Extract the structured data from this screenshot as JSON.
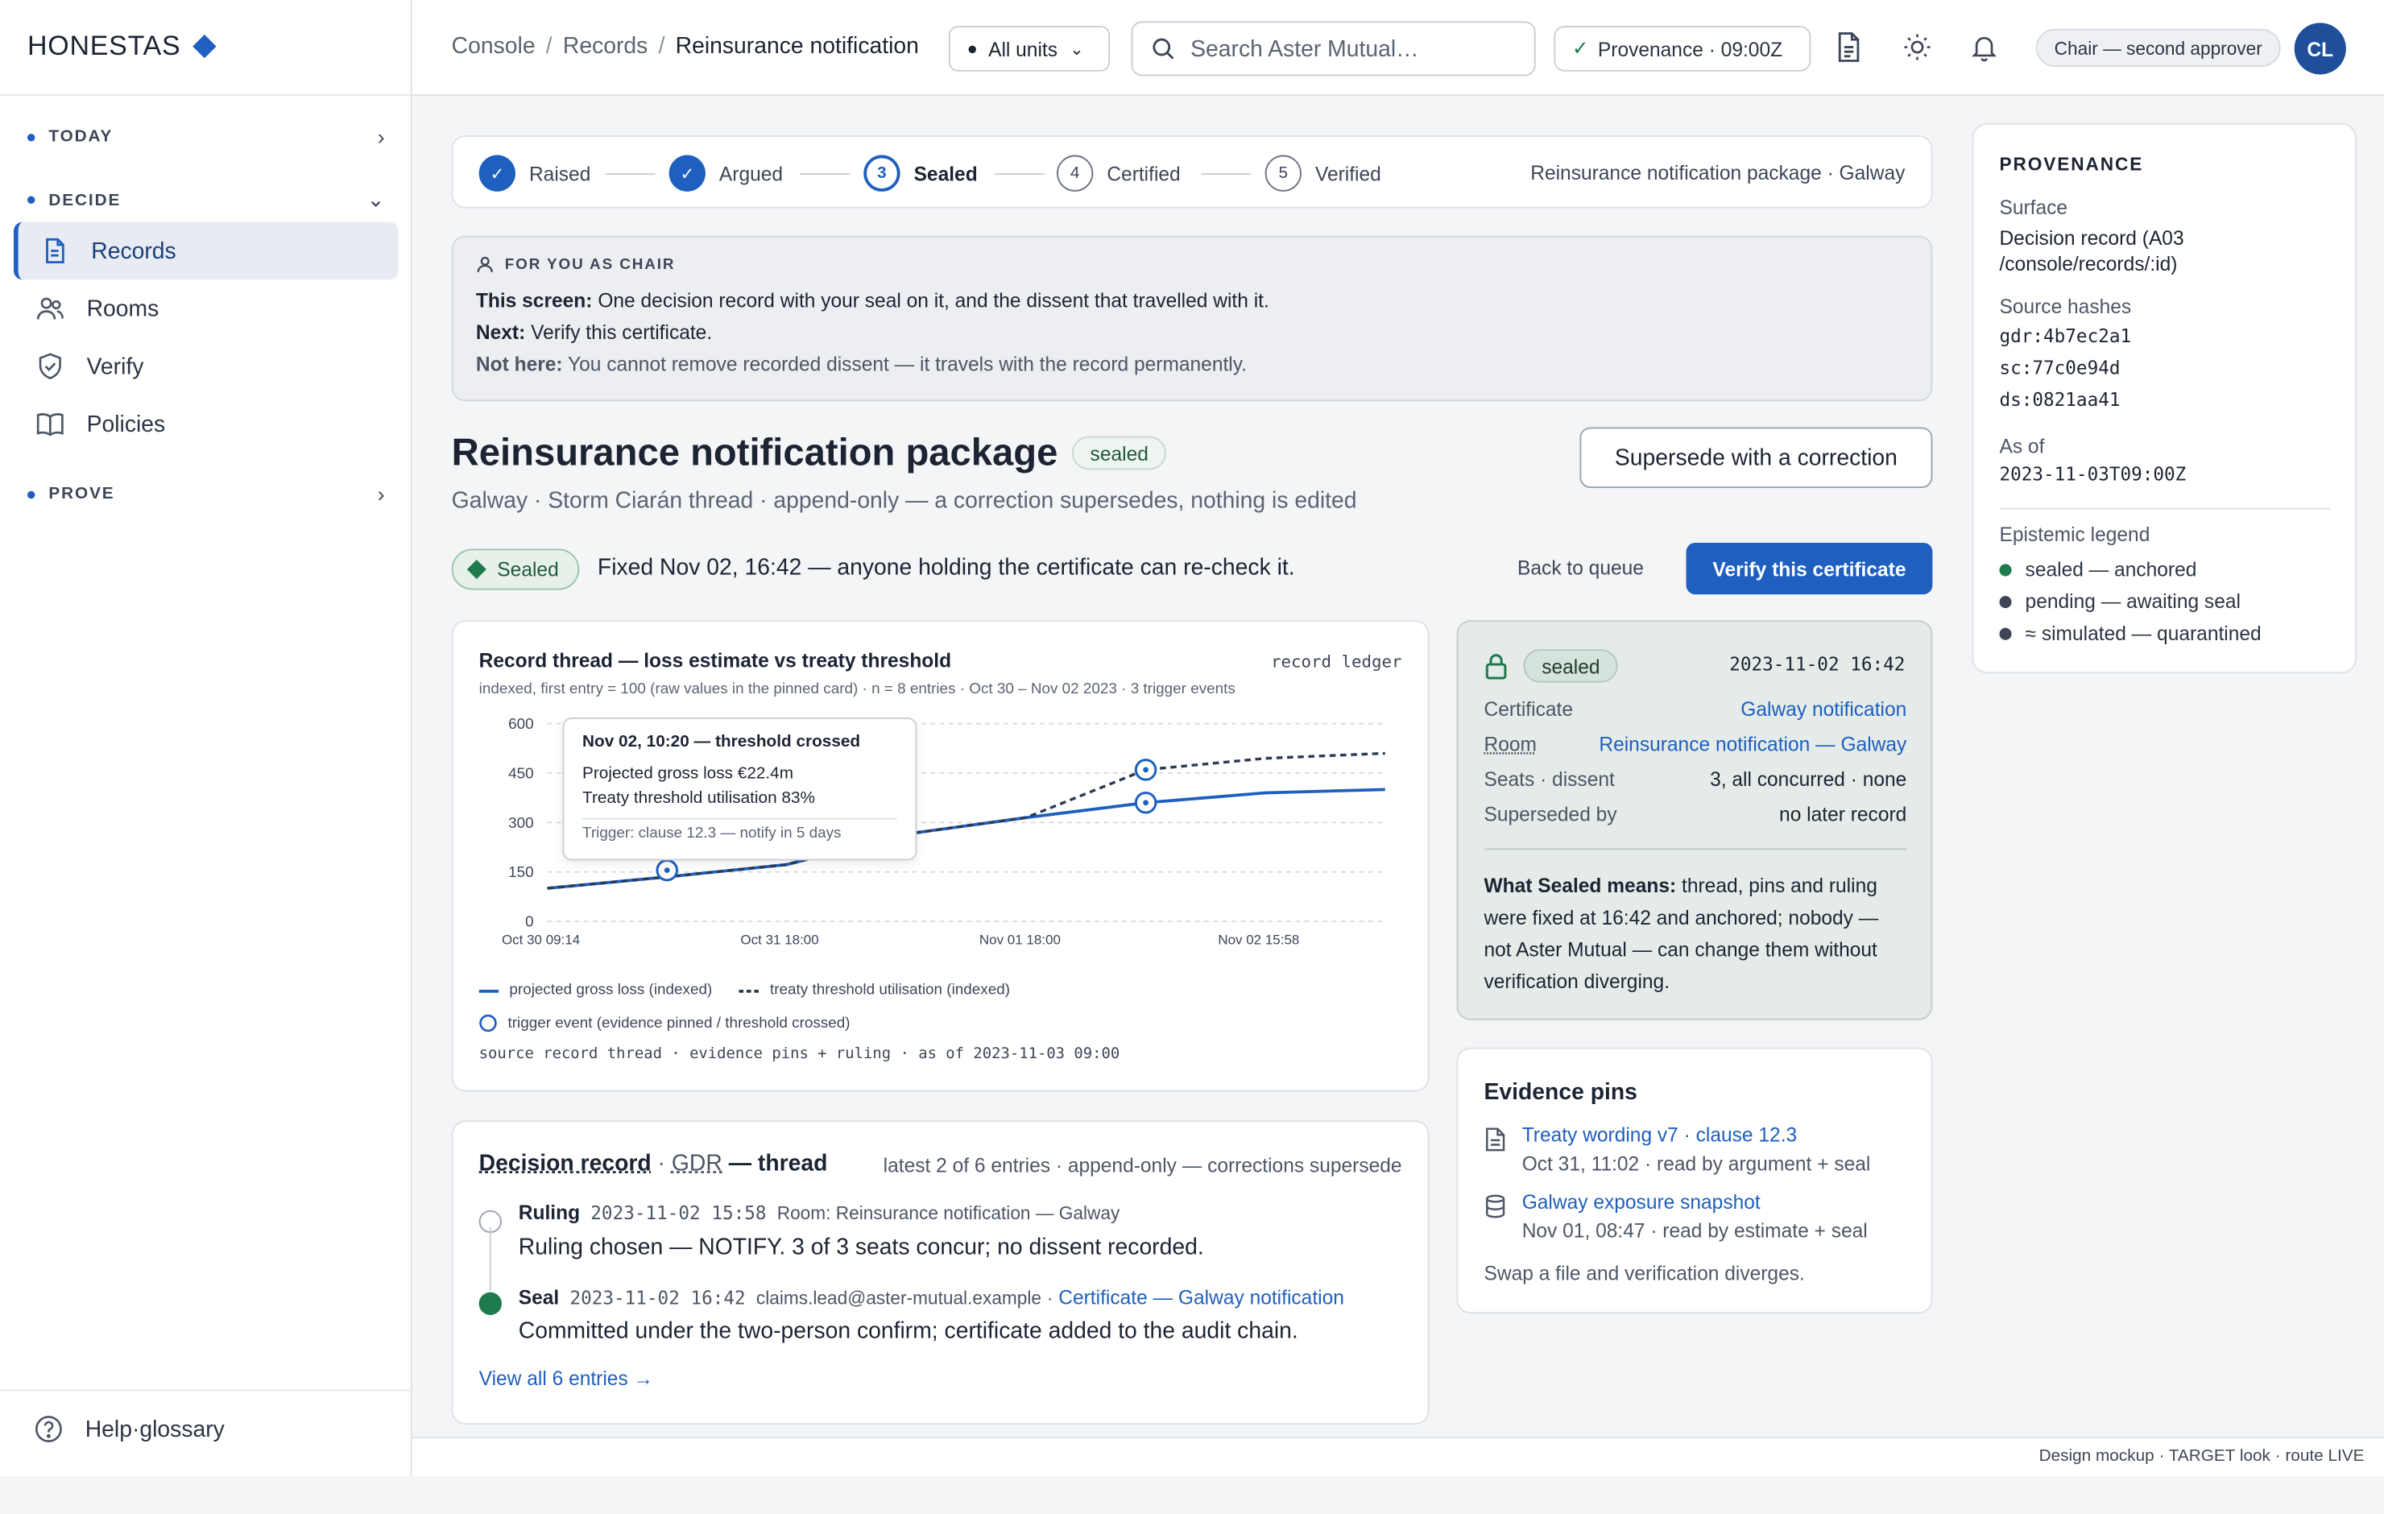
{
  "brand": {
    "name": "HONESTAS"
  },
  "sidebar": {
    "sections": [
      {
        "label": "TODAY"
      },
      {
        "label": "DECIDE"
      },
      {
        "label": "PROVE"
      }
    ],
    "items": [
      {
        "label": "Records",
        "icon": "document-icon",
        "active": true
      },
      {
        "label": "Rooms",
        "icon": "people-icon"
      },
      {
        "label": "Verify",
        "icon": "shield-check-icon"
      },
      {
        "label": "Policies",
        "icon": "book-icon"
      }
    ],
    "help": "Help·glossary"
  },
  "topbar": {
    "breadcrumbs": [
      "Console",
      "Records",
      "Reinsurance notification"
    ],
    "units": "All units",
    "search_placeholder": "Search Aster Mutual…",
    "provenance": "Provenance · 09:00Z",
    "role": "Chair — second approver",
    "avatar": "CL"
  },
  "stepper": {
    "steps": [
      {
        "n": "1",
        "label": "Raised",
        "state": "done"
      },
      {
        "n": "2",
        "label": "Argued",
        "state": "done"
      },
      {
        "n": "3",
        "label": "Sealed",
        "state": "current"
      },
      {
        "n": "4",
        "label": "Certified",
        "state": "todo"
      },
      {
        "n": "5",
        "label": "Verified",
        "state": "todo"
      }
    ],
    "context": "Reinsurance notification package · Galway"
  },
  "note": {
    "heading": "FOR YOU AS CHAIR",
    "screen_k": "This screen:",
    "screen_v": "One decision record with your seal on it, and the dissent that travelled with it.",
    "next_k": "Next:",
    "next_v": "Verify this certificate.",
    "not_k": "Not here:",
    "not_v": "You cannot remove recorded dissent — it travels with the record permanently."
  },
  "record": {
    "title": "Reinsurance notification package",
    "badge": "sealed",
    "subtitle": "Galway · Storm Ciarán thread · append-only — a correction supersedes, nothing is edited",
    "supersede_button": "Supersede with a correction",
    "sealed_chip": "Sealed",
    "fixed_text": "Fixed Nov 02, 16:42 — anyone holding the certificate can re-check it.",
    "back_link": "Back to queue",
    "verify_button": "Verify this certificate"
  },
  "chart_card": {
    "title": "Record thread — loss estimate vs treaty threshold",
    "tag": "record ledger",
    "subtitle": "indexed, first entry = 100 (raw values in the pinned card) · n = 8 entries · Oct 30 – Nov 02 2023 · 3 trigger events",
    "source": "source record thread · evidence pins + ruling · as of 2023-11-03 09:00",
    "tooltip": {
      "heading": "Nov 02, 10:20 — threshold crossed",
      "line1": "Projected gross loss €22.4m",
      "line2": "Treaty threshold utilisation 83%",
      "footer": "Trigger: clause 12.3 — notify in 5 days"
    }
  },
  "chart_data": {
    "type": "line",
    "x_tick_labels": [
      "Oct 30 09:14",
      "Oct 31 18:00",
      "Nov 01 18:00",
      "Nov 02 15:58"
    ],
    "ylim": [
      0,
      600
    ],
    "y_ticks": [
      0,
      150,
      300,
      450,
      600
    ],
    "grid": true,
    "legend_position": "bottom",
    "series": [
      {
        "name": "projected gross loss (indexed)",
        "style": "solid",
        "color": "#1f5fbf",
        "values": [
          100,
          135,
          172,
          265,
          315,
          360,
          390,
          400
        ]
      },
      {
        "name": "treaty threshold utilisation (indexed)",
        "style": "dashed",
        "color": "#2b3a55",
        "values": [
          100,
          135,
          172,
          265,
          315,
          460,
          495,
          510
        ]
      }
    ],
    "trigger_series": {
      "name": "trigger event (evidence pinned / threshold crossed)",
      "points": [
        [
          1,
          155
        ],
        [
          5,
          460
        ],
        [
          5,
          360
        ]
      ]
    }
  },
  "seal_card": {
    "badge": "sealed",
    "timestamp": "2023-11-02 16:42",
    "rows": [
      {
        "k": "Certificate",
        "v": "Galway notification",
        "link": true
      },
      {
        "k": "Room",
        "v": "Reinsurance notification — Galway",
        "link": true
      },
      {
        "k": "Seats · dissent",
        "v": "3, all concurred · none",
        "link": false
      },
      {
        "k": "Superseded by",
        "v": "no later record",
        "link": false
      }
    ],
    "what_k": "What Sealed means:",
    "what_v": "thread, pins and ruling were fixed at 16:42 and anchored; nobody — not Aster Mutual — can change them without verification diverging."
  },
  "evidence": {
    "heading": "Evidence pins",
    "items": [
      {
        "title": "Treaty wording v7 · clause 12.3",
        "sub": "Oct 31, 11:02 · read by argument + seal",
        "icon": "document-icon"
      },
      {
        "title": "Galway exposure snapshot",
        "sub": "Nov 01, 08:47 · read by estimate + seal",
        "icon": "database-icon"
      }
    ],
    "footer": "Swap a file and verification diverges."
  },
  "decision": {
    "heading": "Decision record",
    "heading_mid": "GDR",
    "heading_end": "— thread",
    "meta": "latest 2 of 6 entries · append-only — corrections supersede",
    "entries": [
      {
        "kind": "Ruling",
        "ts": "2023-11-02 15:58",
        "extra": "Room: Reinsurance notification — Galway",
        "body": "Ruling chosen — NOTIFY. 3 of 3 seats concur; no dissent recorded."
      },
      {
        "kind": "Seal",
        "ts": "2023-11-02 16:42",
        "extra": "claims.lead@aster-mutual.example",
        "link": "Certificate — Galway notification",
        "body": "Committed under the two-person confirm; certificate added to the audit chain."
      }
    ],
    "view_all": "View all 6 entries →"
  },
  "provenance": {
    "heading": "PROVENANCE",
    "surface_k": "Surface",
    "surface_v1": "Decision record (A03",
    "surface_v2": "/console/records/:id)",
    "hashes_k": "Source hashes",
    "hashes": [
      "gdr:4b7ec2a1",
      "sc:77c0e94d",
      "ds:0821aa41"
    ],
    "asof_k": "As of",
    "asof_v": "2023-11-03T09:00Z",
    "legend_k": "Epistemic legend",
    "legend": [
      {
        "label": "sealed — anchored",
        "color": "#1f7a4d"
      },
      {
        "label": "pending — awaiting seal",
        "color": "#3d4656"
      },
      {
        "label": "≈ simulated — quarantined",
        "color": "#3d4656"
      }
    ]
  },
  "footer": "Design mockup · TARGET look · route LIVE"
}
